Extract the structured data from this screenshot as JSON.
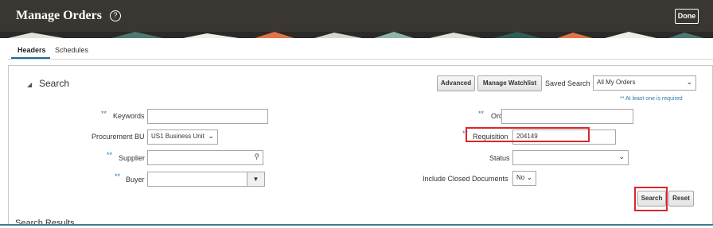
{
  "header": {
    "title": "Manage Orders",
    "help_icon": "?",
    "done_label": "Done"
  },
  "tabs": [
    {
      "label": "Headers",
      "active": true
    },
    {
      "label": "Schedules",
      "active": false
    }
  ],
  "search": {
    "title": "Search",
    "advanced_label": "Advanced",
    "watchlist_label": "Manage Watchlist",
    "saved_search_label": "Saved Search",
    "saved_search_value": "All My Orders",
    "required_note": "** At least one is required",
    "required_mark": "**",
    "fields": {
      "keywords": {
        "label": "Keywords",
        "value": ""
      },
      "procurement_bu": {
        "label": "Procurement BU",
        "value": "US1 Business Unit"
      },
      "supplier": {
        "label": "Supplier",
        "value": ""
      },
      "buyer": {
        "label": "Buyer",
        "value": ""
      },
      "order": {
        "label": "Order",
        "value": ""
      },
      "requisition": {
        "label": "Requisition",
        "value": "204149"
      },
      "status": {
        "label": "Status",
        "value": ""
      },
      "include_closed": {
        "label": "Include Closed Documents",
        "value": "No"
      }
    },
    "search_button": "Search",
    "reset_button": "Reset"
  },
  "results_title": "Search Results",
  "colors": {
    "header_bg": "#3a3632",
    "highlight": "#d9262a",
    "required": "#2a7ab0"
  }
}
